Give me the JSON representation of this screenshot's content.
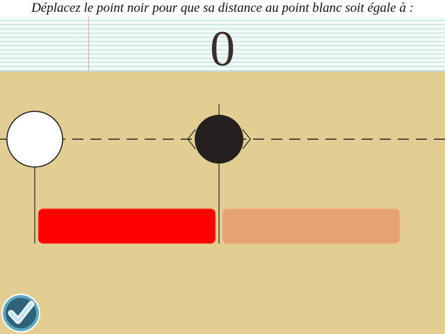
{
  "instruction": "Déplacez le point noir pour que sa distance au point blanc soit égale à :",
  "target_distance": "0",
  "colors": {
    "background": "#e2cd92",
    "bar_left": "#ff0000",
    "bar_right": "#e6a372",
    "black_point": "#261f1f",
    "white_point": "#ffffff",
    "check_button": "#2f6478"
  },
  "icons": {
    "validate": "checkmark-icon",
    "drag_arrows": "chevron-left-right-icon"
  }
}
